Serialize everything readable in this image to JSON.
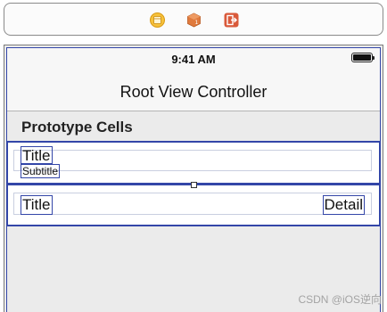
{
  "scene_dock": {
    "icons": [
      "view-controller-icon",
      "first-responder-icon",
      "exit-icon"
    ],
    "colors": {
      "view_controller": "#f6c13b",
      "first_responder": "#e07a3d",
      "exit": "#d9593a"
    }
  },
  "status_bar": {
    "time": "9:41 AM"
  },
  "nav_bar": {
    "title": "Root View Controller"
  },
  "table": {
    "section_header": "Prototype Cells",
    "cells": [
      {
        "style": "subtitle",
        "title": "Title",
        "subtitle": "Subtitle"
      },
      {
        "style": "right-detail",
        "title": "Title",
        "detail": "Detail"
      }
    ]
  },
  "watermark": "CSDN @iOS逆向",
  "colors": {
    "selection_outline": "#3346a8",
    "canvas_background": "#ebebeb"
  }
}
